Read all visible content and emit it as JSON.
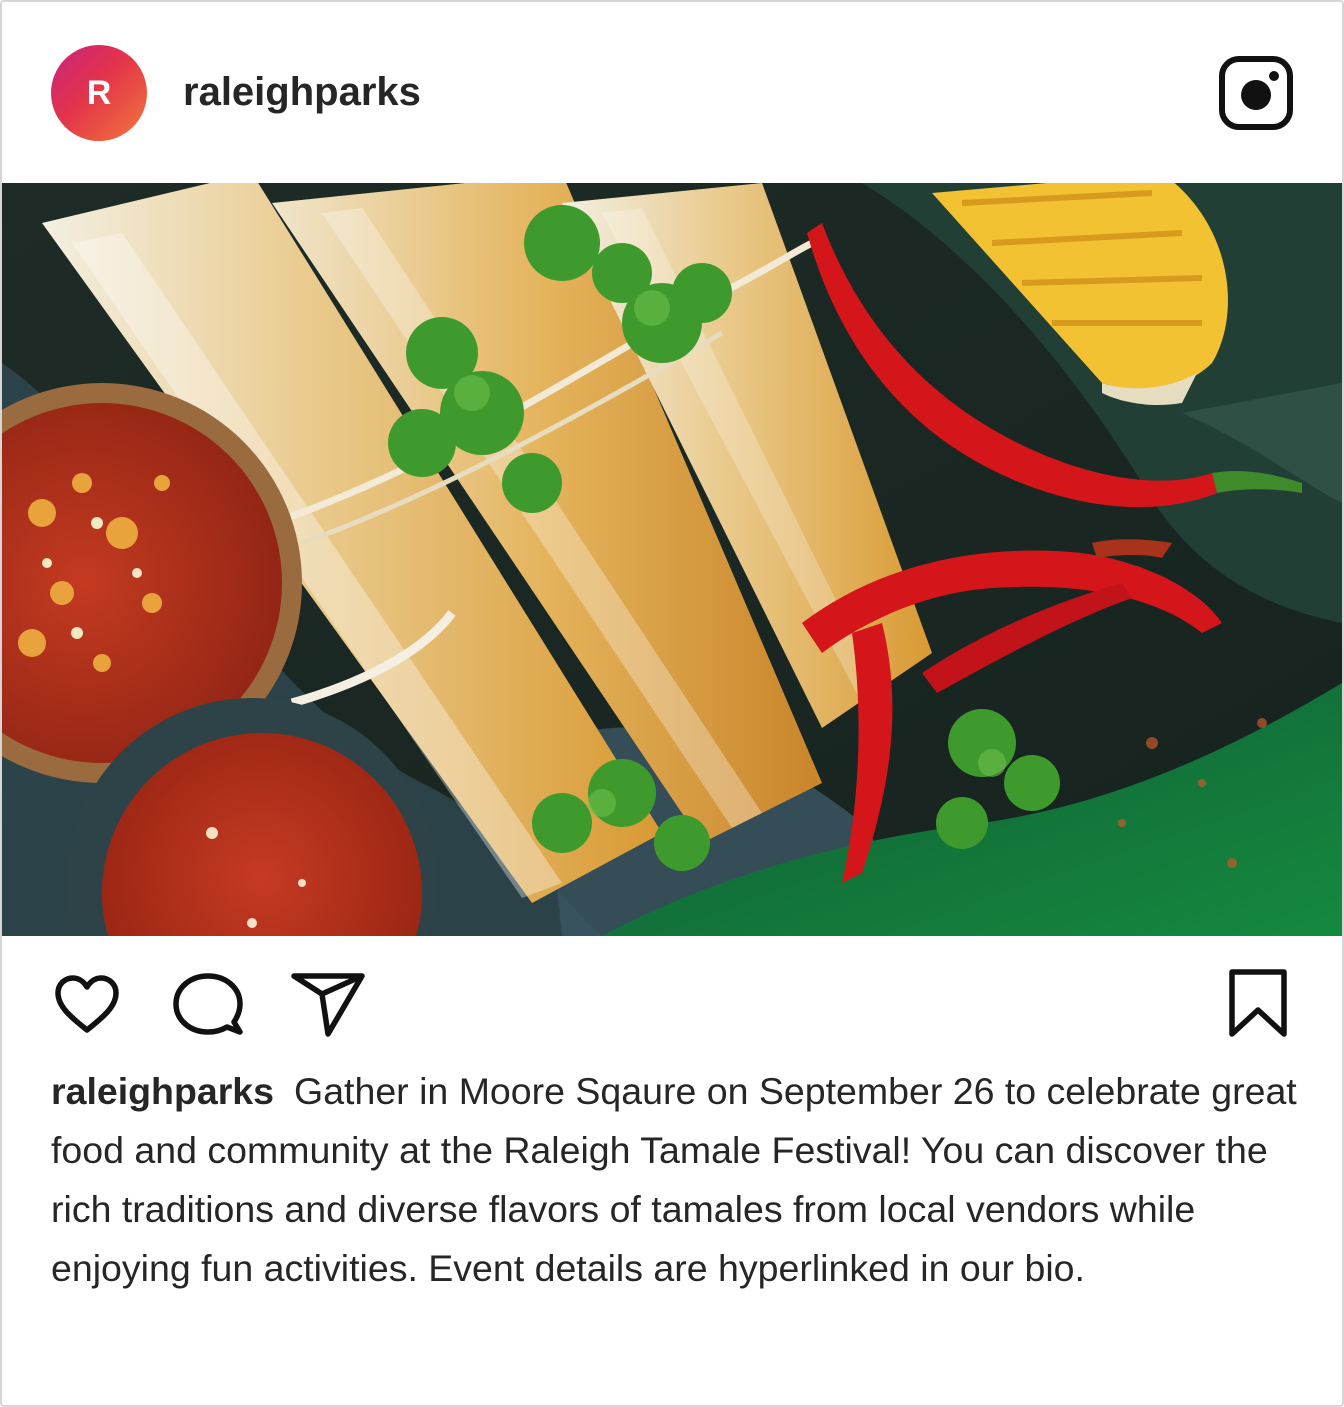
{
  "post": {
    "avatar_initial": "R",
    "username": "raleighparks",
    "image": {
      "subject": "tamales-with-peppers-corn-salsa",
      "colors": {
        "dark_leaf": "#1e2b26",
        "husk": "#e2b25a",
        "chili_red": "#d4161b",
        "corn_yellow": "#f2c233",
        "salsa_red": "#b8301a",
        "cilantro_green": "#3f9a2e",
        "grass_green": "#137a3f"
      }
    },
    "actions": {
      "like_icon": "heart-icon",
      "comment_icon": "comment-icon",
      "share_icon": "share-icon",
      "save_icon": "bookmark-icon"
    },
    "caption": {
      "username": "raleighparks",
      "text": "Gather in Moore Sqaure on September 26 to celebrate great food and community at the Raleigh Tamale Festival! You can discover the rich traditions and diverse flavors of tamales from local vendors while enjoying fun activities. Event details are hyperlinked in our bio."
    }
  },
  "theme": {
    "text": "#262626",
    "border": "#d6d6d6",
    "avatar_gradient": [
      "#c9217f",
      "#e3344a",
      "#f3783a"
    ]
  }
}
